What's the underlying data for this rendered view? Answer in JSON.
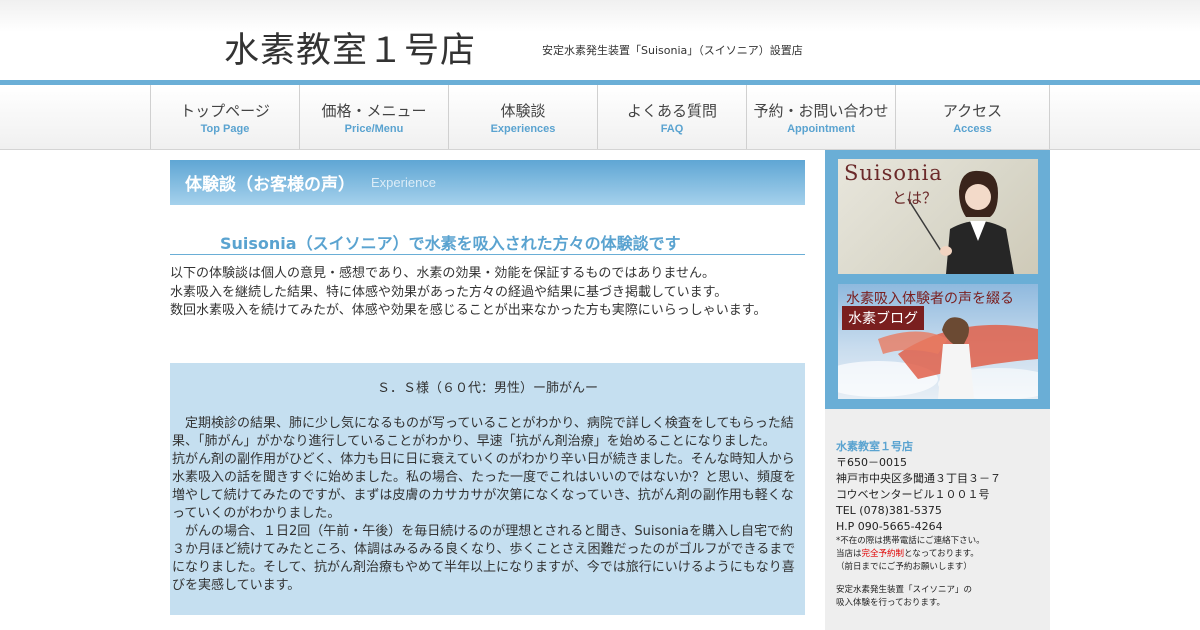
{
  "header": {
    "site_title": "水素教室１号店",
    "tagline": "安定水素発生装置「Suisonia」（スイソニア）設置店"
  },
  "nav": {
    "items": [
      {
        "jp": "トップページ",
        "en": "Top Page"
      },
      {
        "jp": "価格・メニュー",
        "en": "Price/Menu"
      },
      {
        "jp": "体験談",
        "en": "Experiences"
      },
      {
        "jp": "よくある質問",
        "en": "FAQ"
      },
      {
        "jp": "予約・お問い合わせ",
        "en": "Appointment"
      },
      {
        "jp": "アクセス",
        "en": "Access"
      }
    ]
  },
  "main": {
    "heading_jp": "体験談（お客様の声）",
    "heading_en": "Experience",
    "subheading": "Suisonia（スイソニア）で水素を吸入された方々の体験談です",
    "intro": [
      "以下の体験談は個人の意見・感想であり、水素の効果・効能を保証するものではありません。",
      "水素吸入を継続した結果、特に体感や効果があった方々の経過や結果に基づき掲載しています。",
      "数回水素吸入を続けてみたが、体感や効果を感じることが出来なかった方も実際にいらっしゃいます。"
    ],
    "testimonial": {
      "title": "Ｓ．Ｓ様（６０代：男性）ー肺がんー",
      "paragraphs": [
        "　定期検診の結果、肺に少し気になるものが写っていることがわかり、病院で詳しく検査をしてもらった結果、「肺がん」がかなり進行していることがわかり、早速「抗がん剤治療」を始めることになりました。",
        "抗がん剤の副作用がひどく、体力も日に日に衰えていくのがわかり辛い日が続きました。そんな時知人から水素吸入の話を聞きすぐに始めました。私の場合、たった一度でこれはいいのではないか？と思い、頻度を増やして続けてみたのですが、まずは皮膚のカサカサが次第になくなっていき、抗がん剤の副作用も軽くなっていくのがわかりました。",
        "　がんの場合、１日2回（午前・午後）を毎日続けるのが理想とされると聞き、Suisoniaを購入し自宅で約３か月ほど続けてみたところ、体調はみるみる良くなり、歩くことさえ困難だったのがゴルフができるまでになりました。そして、抗がん剤治療もやめて半年以上になりますが、今では旅行にいけるようにもなり喜びを実感しています。"
      ]
    }
  },
  "sidebar": {
    "banner1": {
      "title": "Suisonia",
      "sub": "とは？"
    },
    "banner2": {
      "title": "水素吸入体験者の声を綴る",
      "tag": "水素ブログ"
    },
    "info": {
      "name": "水素教室１号店",
      "postal": "〒650－0015",
      "address1": "神戸市中央区多聞通３丁目３－７",
      "address2": "コウベセンタービル１００１号",
      "tel": "TEL (078)381-5375",
      "hp": "H.P 090-5665-4264",
      "note1": "*不在の際は携帯電話にご連絡下さい。",
      "note2_pre": "当店は",
      "note2_red": "完全予約制",
      "note2_post": "となっております。",
      "note3": "（前日までにご予約お願いします）",
      "note4": "安定水素発生装置「スイソニア」の",
      "note5": "吸入体験を行っております。"
    }
  },
  "colors": {
    "accent": "#6aaed6",
    "accent_text": "#5aa3d0",
    "testimonial_bg": "#c5dff0",
    "sidebar_info_bg": "#eeeeee",
    "emphasis_red": "#e00000"
  }
}
